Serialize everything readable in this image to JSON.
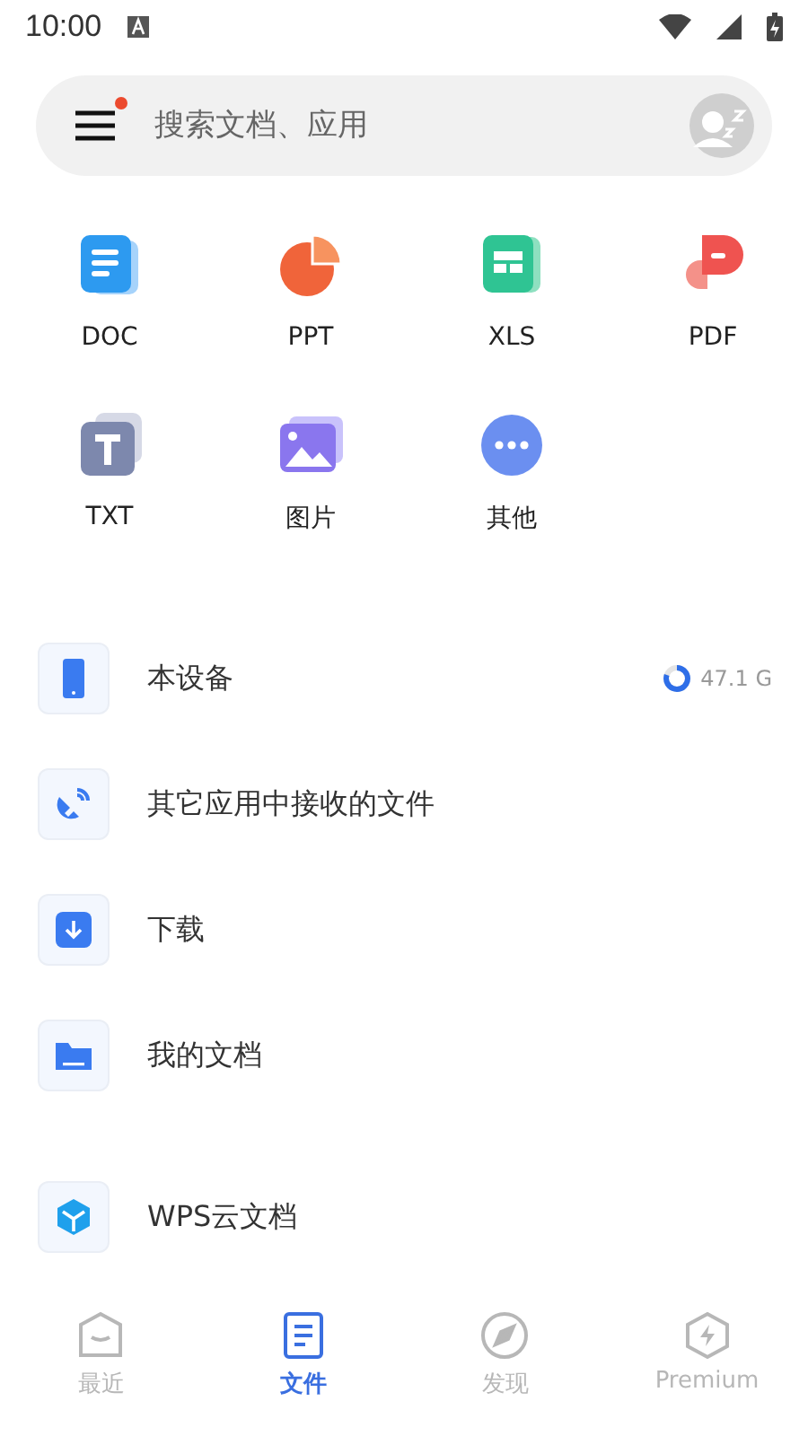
{
  "status_bar": {
    "time": "10:00"
  },
  "search": {
    "placeholder": "搜索文档、应用",
    "menu_unread": true
  },
  "file_types": [
    {
      "kind": "doc",
      "label": "DOC"
    },
    {
      "kind": "ppt",
      "label": "PPT"
    },
    {
      "kind": "xls",
      "label": "XLS"
    },
    {
      "kind": "pdf",
      "label": "PDF"
    },
    {
      "kind": "txt",
      "label": "TXT"
    },
    {
      "kind": "image",
      "label": "图片"
    },
    {
      "kind": "other",
      "label": "其他"
    }
  ],
  "locations": [
    {
      "kind": "device",
      "label": "本设备",
      "storage": {
        "level": 0.8,
        "reading": "47.1 G"
      }
    },
    {
      "kind": "received",
      "label": "其它应用中接收的文件"
    },
    {
      "kind": "download",
      "label": "下载"
    },
    {
      "kind": "documents",
      "label": "我的文档"
    },
    {
      "kind": "cloud",
      "label": "WPS云文档"
    }
  ],
  "tabs": [
    {
      "kind": "recent",
      "label": "最近",
      "selected": false
    },
    {
      "kind": "files",
      "label": "文件",
      "selected": true
    },
    {
      "kind": "discover",
      "label": "发现",
      "selected": false
    },
    {
      "kind": "premium",
      "label": "Premium",
      "selected": false
    }
  ]
}
